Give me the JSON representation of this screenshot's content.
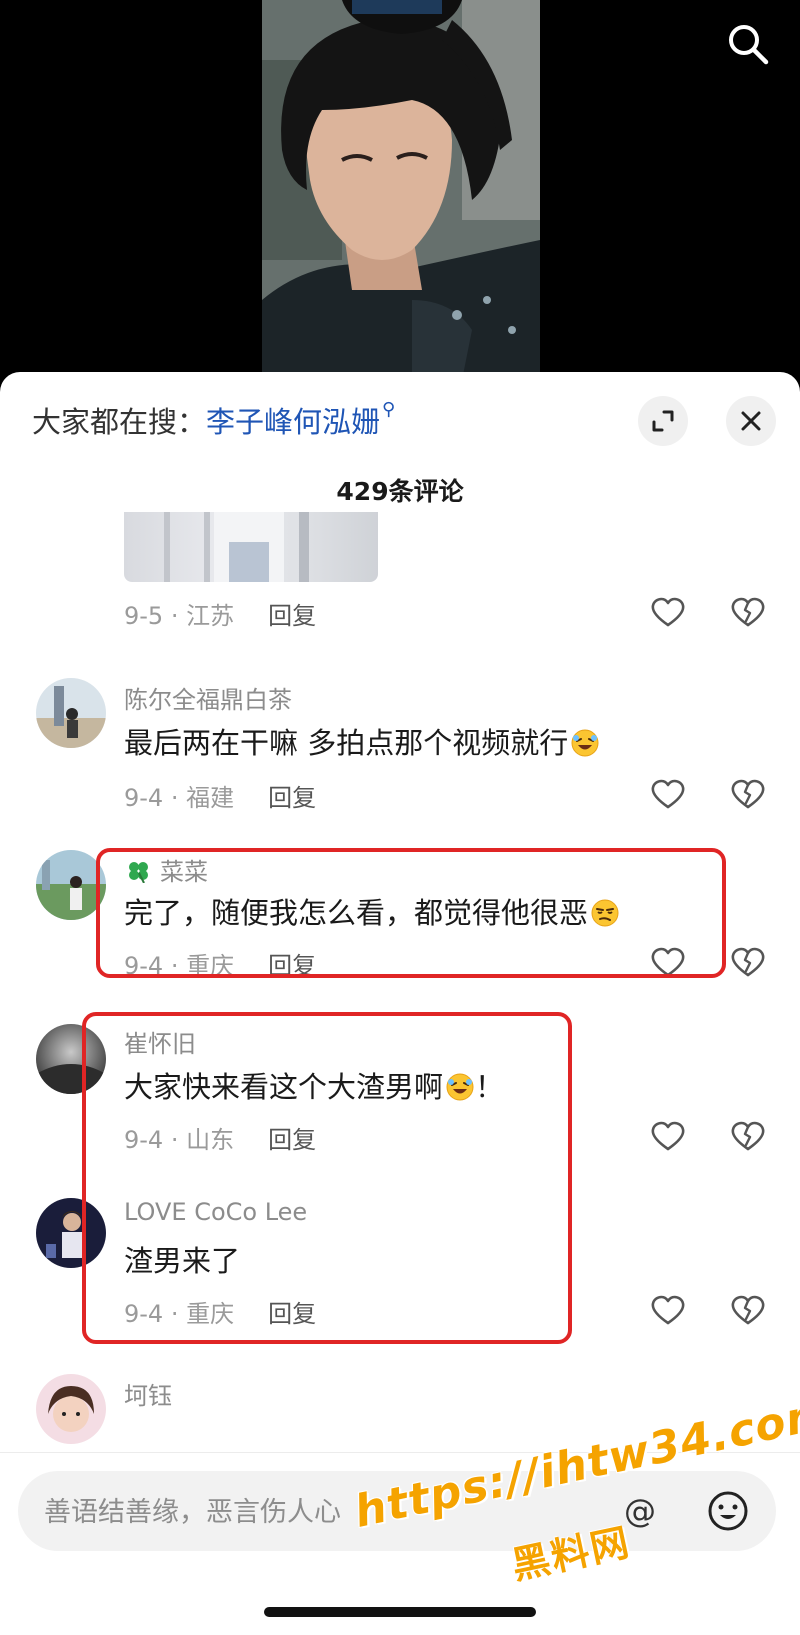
{
  "header": {
    "trending_prefix": "大家都在搜：",
    "trending_query": "李子峰何泓姗",
    "comment_count": "429条评论"
  },
  "partial_comment": {
    "date_location": "9-5 · 江苏",
    "reply_label": "回复"
  },
  "comments": [
    {
      "username": "陈尔全福鼎白茶",
      "text": "最后两在干嘛  多拍点那个视频就行",
      "date_location": "9-4 · 福建",
      "reply_label": "回复",
      "emoji": "rofl-emoji"
    },
    {
      "username_prefix_icon": "clover-icon",
      "username": "菜菜",
      "text": "完了，随便我怎么看，都觉得他很恶",
      "date_location": "9-4 · 重庆",
      "reply_label": "回复",
      "emoji": "smirk-emoji"
    },
    {
      "username": "崔怀旧",
      "text": "大家快来看这个大渣男啊",
      "text_suffix": "！",
      "date_location": "9-4 · 山东",
      "reply_label": "回复",
      "emoji": "rofl-emoji"
    },
    {
      "username": "LOVE CoCo Lee",
      "text": "渣男来了",
      "date_location": "9-4 · 重庆",
      "reply_label": "回复"
    },
    {
      "username": "坷钰"
    }
  ],
  "input": {
    "placeholder": "善语结善缘，恶言伤人心",
    "at_label": "@"
  },
  "watermark": {
    "url": "https://ihtw34.com",
    "name": "黑料网"
  },
  "colors": {
    "link_blue": "#1f55b5",
    "highlight_red": "#e02525",
    "watermark_orange": "#f5a300"
  }
}
